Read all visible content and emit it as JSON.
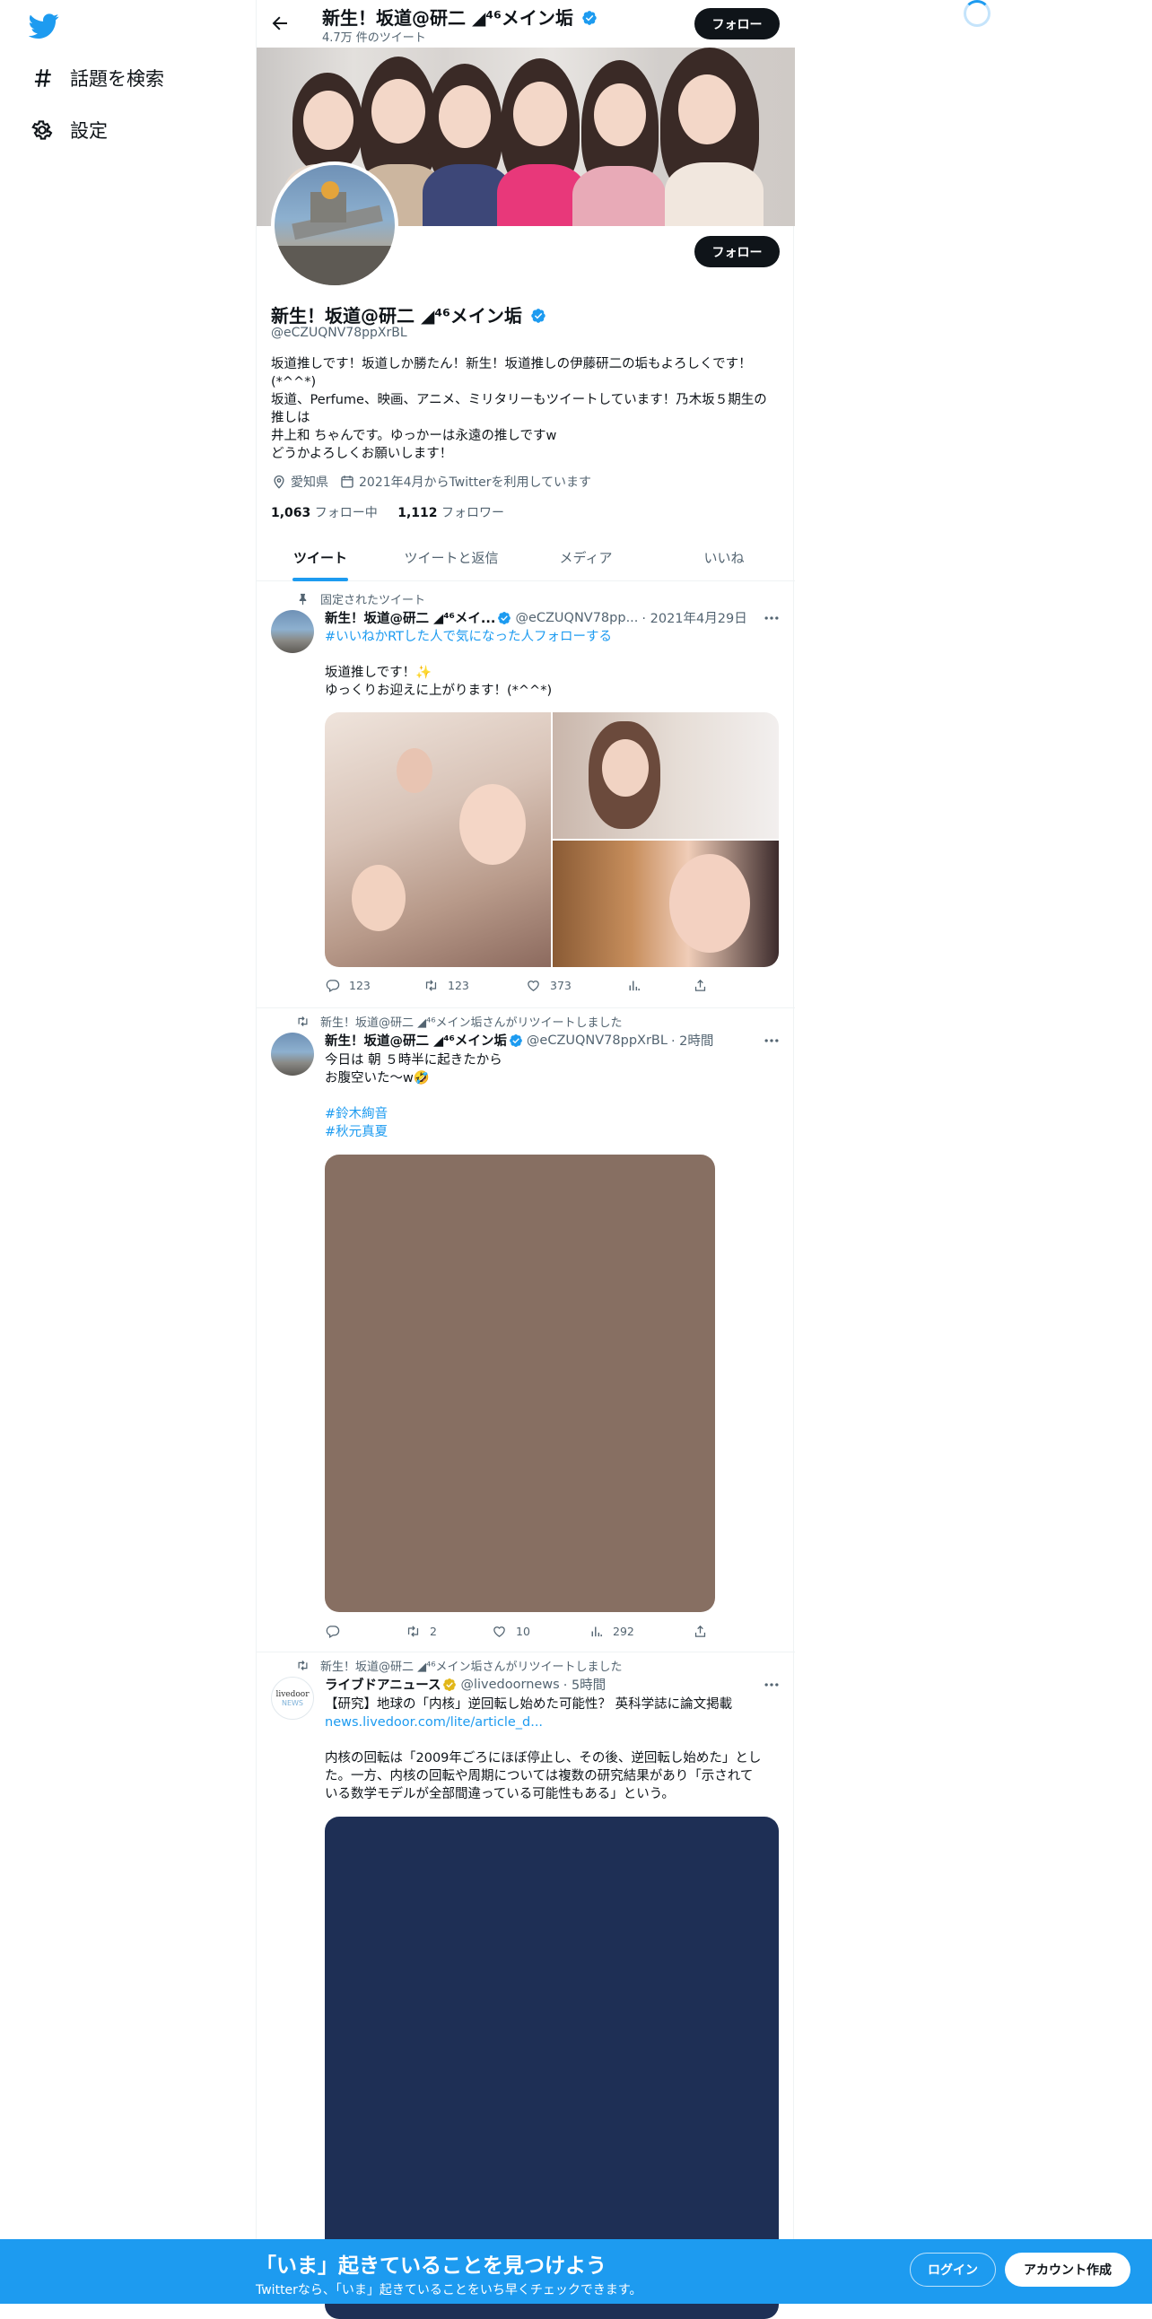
{
  "sidebar": {
    "logo": "twitter-bird-icon",
    "items": [
      {
        "label": "話題を検索",
        "icon": "hash-icon"
      },
      {
        "label": "設定",
        "icon": "gear-icon"
      }
    ]
  },
  "header": {
    "name": "新生！坂道@研二 ◢⁴⁶メイン垢",
    "tweet_count": "4.7万 件のツイート",
    "follow_label": "フォロー"
  },
  "profile": {
    "name": "新生！坂道@研二 ◢⁴⁶メイン垢",
    "handle": "@eCZUQNV78ppXrBL",
    "follow_label": "フォロー",
    "bio": [
      "坂道推しです！坂道しか勝たん！新生！坂道推しの伊藤研二の垢もよろしくです！",
      "(*^^*)",
      "坂道、Perfume、映画、アニメ、ミリタリーもツイートしています！乃木坂５期生の",
      "推しは",
      "井上和 ちゃんです。ゆっかーは永遠の推しですw",
      "どうかよろしくお願いします！"
    ],
    "location": "愛知県",
    "joined": "2021年4月からTwitterを利用しています",
    "following_count": "1,063",
    "following_label": "フォロー中",
    "followers_count": "1,112",
    "followers_label": "フォロワー"
  },
  "tabs": [
    "ツイート",
    "ツイートと返信",
    "メディア",
    "いいね"
  ],
  "active_tab": "ツイート",
  "tweets": [
    {
      "context": "固定されたツイート",
      "name": "新生！坂道@研二 ◢⁴⁶メイ...",
      "handle": "@eCZUQNV78pp...",
      "time": "· 2021年4月29日",
      "lines": [
        "#いいねかRTした人で気になった人フォローする",
        "",
        "坂道推しです！✨",
        "ゆっくりお迎えに上がります！(*^^*)"
      ],
      "replies": "123",
      "retweets": "123",
      "likes": "373",
      "views": ""
    },
    {
      "context": "新生！坂道@研二 ◢⁴⁶メイン垢さんがリツイートしました",
      "name": "新生！坂道@研二 ◢⁴⁶メイン垢",
      "handle": "@eCZUQNV78ppXrBL",
      "time": "· 2時間",
      "lines": [
        "今日は 朝 ５時半に起きたから",
        "お腹空いた～w🤣",
        "",
        "#鈴木絢音",
        "#秋元真夏"
      ],
      "replies": "",
      "retweets": "2",
      "likes": "10",
      "views": "292"
    },
    {
      "context": "新生！坂道@研二 ◢⁴⁶メイン垢さんがリツイートしました",
      "name": "ライブドアニュース",
      "handle": "@livedoornews",
      "time": "· 5時間",
      "avatar_text_1": "livedoor",
      "avatar_text_2": "NEWS",
      "lines": [
        "【研究】地球の「内核」逆回転し始めた可能性？ 英科学誌に論文掲載",
        "news.livedoor.com/lite/article_d...",
        "",
        "内核の回転は「2009年ごろにほぼ停止し、その後、逆回転し始めた」とし",
        "た。一方、内核の回転や周期については複数の研究結果があり「示されて",
        "いる数学モデルが全部間違っている可能性もある」という。"
      ]
    }
  ],
  "bottom_bar": {
    "title": "「いま」起きていることを見つけよう",
    "subtitle": "Twitterなら、「いま」起きていることをいち早くチェックできます。",
    "login_label": "ログイン",
    "signup_label": "アカウント作成"
  },
  "colors": {
    "accent": "#1d9bf0",
    "text": "#0f1419",
    "muted": "#536471",
    "media_placeholder_1": "#876f62",
    "media_placeholder_2": "#1e2f55"
  }
}
